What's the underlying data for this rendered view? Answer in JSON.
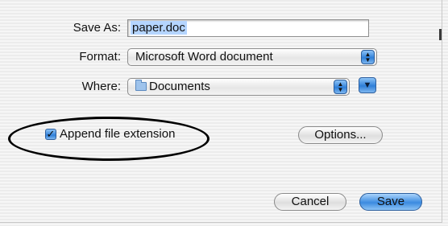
{
  "dialog": {
    "save_as_label": "Save As:",
    "filename_value": "paper.doc",
    "format_label": "Format:",
    "format_value": "Microsoft Word document",
    "where_label": "Where:",
    "where_value": "Documents",
    "append_extension_label": "Append file extension",
    "append_extension_checked": true,
    "options_button": "Options...",
    "cancel_button": "Cancel",
    "save_button": "Save"
  },
  "colors": {
    "accent_blue": "#3b8be0",
    "selection": "#b5d5ff",
    "annotation": "#000000"
  },
  "icons": {
    "stepper": "up-down-arrows",
    "expand": "triangle-down",
    "folder": "folder-icon",
    "check": "checkmark"
  }
}
